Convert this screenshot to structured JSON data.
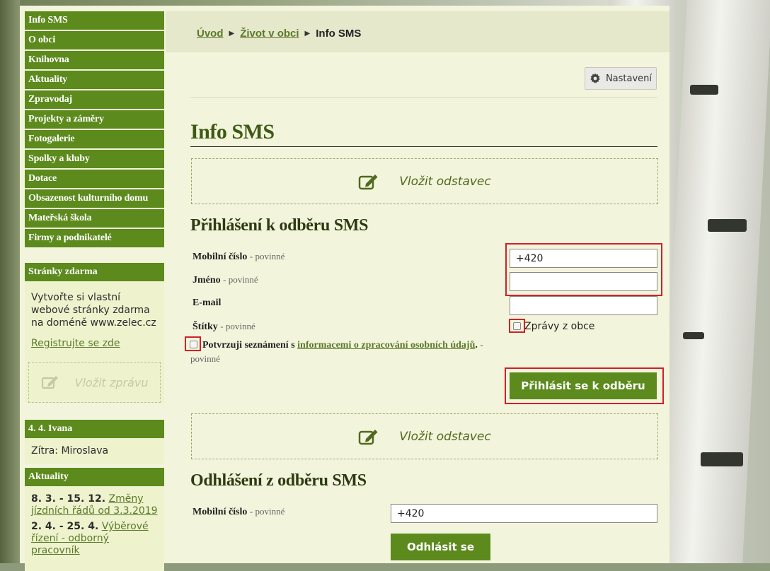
{
  "menu": [
    "Info SMS",
    "O obci",
    "Knihovna",
    "Aktuality",
    "Zpravodaj",
    "Projekty a záměry",
    "Fotogalerie",
    "Spolky a kluby",
    "Dotace",
    "Obsazenost kulturního domu",
    "Mateřská škola",
    "Firmy a podnikatelé"
  ],
  "promo": {
    "title": "Stránky zdarma",
    "text": "Vytvořte si vlastní webové stránky zdarma na doméně www.zelec.cz",
    "link": "Registrujte se zde",
    "insert_message": "Vložit zprávu"
  },
  "namedays": {
    "title": "4. 4. Ivana",
    "tomorrow": "Zítra: Miroslava"
  },
  "news": {
    "title": "Aktuality",
    "items": [
      {
        "date": "8. 3. - 15. 12.",
        "link": "Změny jízdních řádů od 3.3.2019"
      },
      {
        "date": "2. 4. - 25. 4.",
        "link": "Výběrové řízení - odborný pracovník"
      }
    ]
  },
  "breadcrumb": {
    "home": "Úvod",
    "section": "Život v obci",
    "current": "Info SMS"
  },
  "settings_label": "Nastavení",
  "page_title": "Info SMS",
  "insert_paragraph": "Vložit odstavec",
  "subscribe": {
    "title": "Přihlášení k odběru SMS",
    "mobile_label": "Mobilní číslo",
    "name_label": "Jméno",
    "email_label": "E-mail",
    "tags_label": "Štítky",
    "required": "- povinné",
    "mobile_value": "+420",
    "tag_option": "Zprávy z obce",
    "consent_prefix": "Potvrzuji seznámení s",
    "consent_link": "informacemi o zpracování osobních údajů",
    "consent_suffix": ".",
    "consent_req_dash": "-",
    "consent_req": "povinné",
    "button": "Přihlásit se k odběru"
  },
  "unsubscribe": {
    "title": "Odhlášení z odběru SMS",
    "mobile_label": "Mobilní číslo",
    "required": "- povinné",
    "mobile_value": "+420",
    "button": "Odhlásit se"
  },
  "colors": {
    "brand_green": "#5c8a1c",
    "highlight_red": "#d0202a",
    "page_bg": "#f3f4dc"
  }
}
